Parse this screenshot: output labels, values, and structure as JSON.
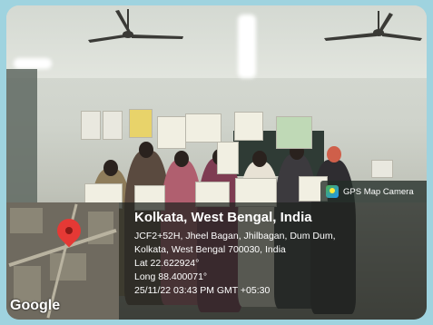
{
  "badge": {
    "label": "GPS Map Camera",
    "icon": "gps-map-camera-logo"
  },
  "map": {
    "watermark": "Google",
    "icon": "location-pin-icon"
  },
  "location": {
    "title": "Kolkata, West Bengal, India",
    "address_line1": "JCF2+52H, Jheel Bagan, Jhilbagan, Dum Dum,",
    "address_line2": "Kolkata, West Bengal 700030, India",
    "lat": "Lat 22.622924°",
    "long": "Long 88.400071°",
    "timestamp": "25/11/22 03:43 PM GMT +05:30"
  },
  "colors": {
    "frame": "#9fd3df",
    "pin": "#e53935",
    "overlay": "#1e221e"
  }
}
